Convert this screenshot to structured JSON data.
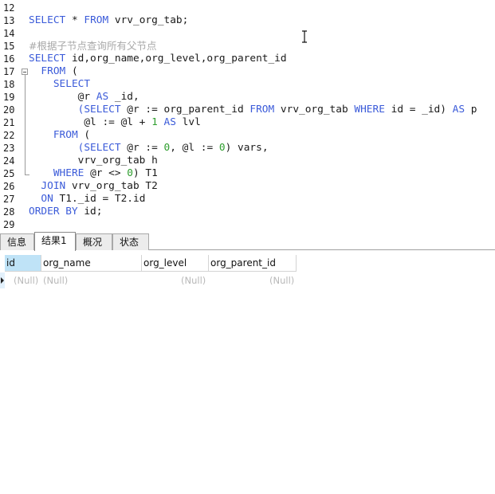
{
  "editor": {
    "lines": [
      {
        "n": "12",
        "segs": []
      },
      {
        "n": "13",
        "segs": [
          {
            "t": "SELECT",
            "c": "kw"
          },
          {
            "t": " * "
          },
          {
            "t": "FROM",
            "c": "kw"
          },
          {
            "t": " vrv_org_tab;"
          }
        ]
      },
      {
        "n": "14",
        "segs": []
      },
      {
        "n": "15",
        "segs": [
          {
            "t": "#根据子节点查询所有父节点",
            "c": "cm"
          }
        ]
      },
      {
        "n": "16",
        "segs": [
          {
            "t": "SELECT",
            "c": "kw"
          },
          {
            "t": " id,org_name,org_level,org_parent_id"
          }
        ]
      },
      {
        "n": "17",
        "segs": [
          {
            "t": "  "
          },
          {
            "t": "FROM",
            "c": "kw"
          },
          {
            "t": " ("
          }
        ]
      },
      {
        "n": "18",
        "segs": [
          {
            "t": "    "
          },
          {
            "t": "SELECT",
            "c": "kw"
          }
        ]
      },
      {
        "n": "19",
        "segs": [
          {
            "t": "        @r "
          },
          {
            "t": "AS",
            "c": "kw"
          },
          {
            "t": " _id,"
          }
        ]
      },
      {
        "n": "20",
        "segs": [
          {
            "t": "        "
          },
          {
            "t": "(SELECT",
            "c": "kw"
          },
          {
            "t": " @r := org_parent_id "
          },
          {
            "t": "FROM",
            "c": "kw"
          },
          {
            "t": " vrv_org_tab "
          },
          {
            "t": "WHERE",
            "c": "kw"
          },
          {
            "t": " id = _id) "
          },
          {
            "t": "AS",
            "c": "kw"
          },
          {
            "t": " p"
          }
        ]
      },
      {
        "n": "21",
        "segs": [
          {
            "t": "         @l := @l + "
          },
          {
            "t": "1",
            "c": "num"
          },
          {
            "t": " "
          },
          {
            "t": "AS",
            "c": "kw"
          },
          {
            "t": " lvl"
          }
        ]
      },
      {
        "n": "22",
        "segs": [
          {
            "t": "    "
          },
          {
            "t": "FROM",
            "c": "kw"
          },
          {
            "t": " ("
          }
        ]
      },
      {
        "n": "23",
        "segs": [
          {
            "t": "        "
          },
          {
            "t": "(SELECT",
            "c": "kw"
          },
          {
            "t": " @r := "
          },
          {
            "t": "0",
            "c": "num"
          },
          {
            "t": ", @l := "
          },
          {
            "t": "0",
            "c": "num"
          },
          {
            "t": ") vars,"
          }
        ]
      },
      {
        "n": "24",
        "segs": [
          {
            "t": "        vrv_org_tab h"
          }
        ]
      },
      {
        "n": "25",
        "segs": [
          {
            "t": "    "
          },
          {
            "t": "WHERE",
            "c": "kw"
          },
          {
            "t": " @r <> "
          },
          {
            "t": "0",
            "c": "num"
          },
          {
            "t": ") T1"
          }
        ]
      },
      {
        "n": "26",
        "segs": [
          {
            "t": "  "
          },
          {
            "t": "JOIN",
            "c": "kw"
          },
          {
            "t": " vrv_org_tab T2"
          }
        ]
      },
      {
        "n": "27",
        "segs": [
          {
            "t": "  "
          },
          {
            "t": "ON",
            "c": "kw"
          },
          {
            "t": " T1._id = T2.id"
          }
        ]
      },
      {
        "n": "28",
        "segs": [
          {
            "t": "ORDER BY",
            "c": "kw"
          },
          {
            "t": " id;"
          }
        ]
      },
      {
        "n": "29",
        "segs": []
      }
    ]
  },
  "tabs": [
    {
      "label": "信息",
      "active": false
    },
    {
      "label": "结果1",
      "active": true
    },
    {
      "label": "概况",
      "active": false
    },
    {
      "label": "状态",
      "active": false
    }
  ],
  "result": {
    "columns": [
      "id",
      "org_name",
      "org_level",
      "org_parent_id"
    ],
    "row": [
      "(Null)",
      "(Null)",
      "(Null)",
      "(Null)"
    ]
  },
  "colors": {
    "keyword": "#3b5bd9",
    "number": "#2e9e2e",
    "comment": "#a8a8a8",
    "selected_header": "#bfe3f7"
  }
}
